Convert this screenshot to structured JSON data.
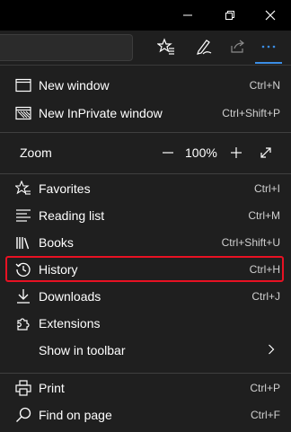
{
  "menu": {
    "new_window": {
      "label": "New window",
      "shortcut": "Ctrl+N"
    },
    "new_inprivate": {
      "label": "New InPrivate window",
      "shortcut": "Ctrl+Shift+P"
    },
    "zoom": {
      "label": "Zoom",
      "value": "100%"
    },
    "favorites": {
      "label": "Favorites",
      "shortcut": "Ctrl+I"
    },
    "reading_list": {
      "label": "Reading list",
      "shortcut": "Ctrl+M"
    },
    "books": {
      "label": "Books",
      "shortcut": "Ctrl+Shift+U"
    },
    "history": {
      "label": "History",
      "shortcut": "Ctrl+H"
    },
    "downloads": {
      "label": "Downloads",
      "shortcut": "Ctrl+J"
    },
    "extensions": {
      "label": "Extensions"
    },
    "show_in_toolbar": {
      "label": "Show in toolbar"
    },
    "print": {
      "label": "Print",
      "shortcut": "Ctrl+P"
    },
    "find_on_page": {
      "label": "Find on page",
      "shortcut": "Ctrl+F"
    }
  },
  "icons": {
    "window_controls": [
      "minimize-icon",
      "restore-icon",
      "close-icon"
    ],
    "toolbar": [
      "favorites-star-icon",
      "pen-icon",
      "share-icon",
      "more-icon"
    ]
  },
  "colors": {
    "accent": "#3b8ee6",
    "highlight_box": "#e81123",
    "menu_background": "#1f1f1f"
  }
}
